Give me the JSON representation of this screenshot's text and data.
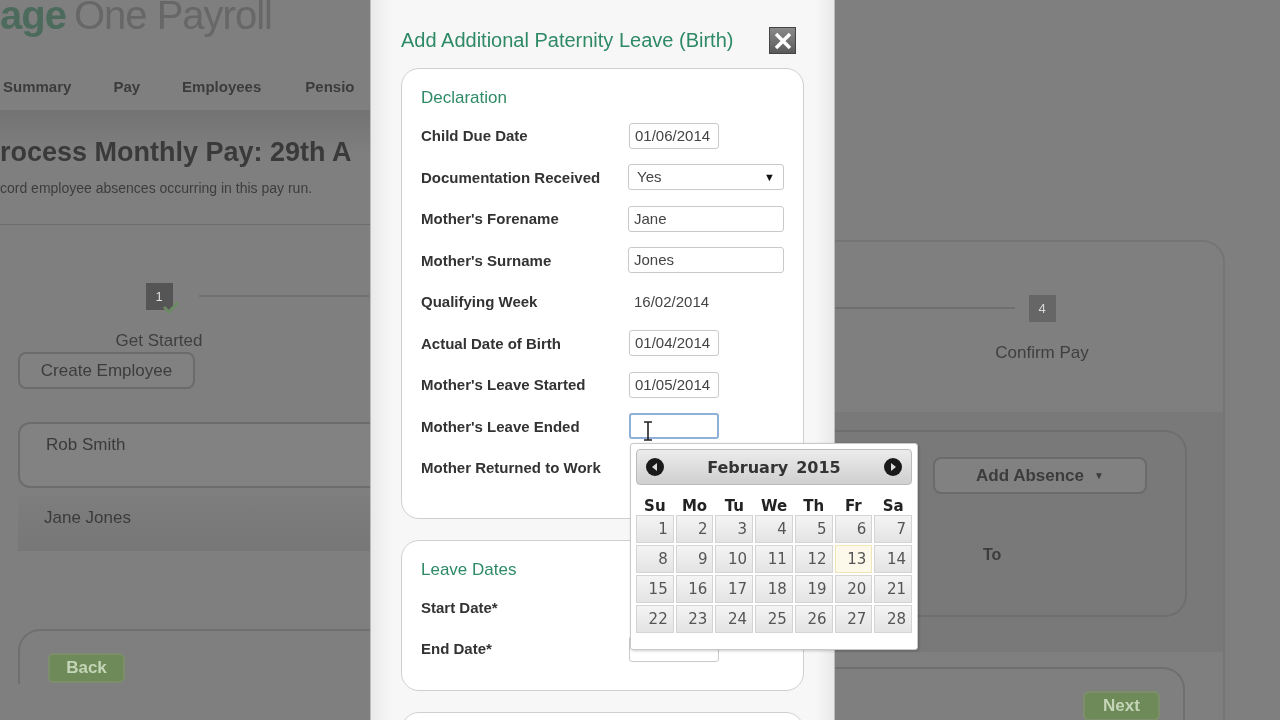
{
  "background": {
    "logo": {
      "brand": "age",
      "product": "One Payroll"
    },
    "nav": [
      {
        "label": "Summary"
      },
      {
        "label": "Pay"
      },
      {
        "label": "Employees"
      },
      {
        "label": "Pensio"
      }
    ],
    "heading": "rocess Monthly Pay: 29th A",
    "subheading": "cord employee absences occurring in this pay run.",
    "steps": [
      {
        "number": "1",
        "label": "Get Started",
        "completed": true
      },
      {
        "number": "4",
        "label": "Confirm Pay",
        "completed": false
      }
    ],
    "create_button": "Create Employee",
    "employees": [
      {
        "name": "Rob Smith",
        "selected": true
      },
      {
        "name": "Jane Jones",
        "selected": false
      }
    ],
    "absence": {
      "button": "Add Absence",
      "caret": "▼",
      "to_label": "To"
    },
    "back_button": "Back",
    "next_button": "Next"
  },
  "dialog": {
    "title": "Add Additional Paternity Leave (Birth)",
    "sections": [
      {
        "title": "Declaration",
        "fields": [
          {
            "label": "Child Due Date",
            "kind": "date",
            "value": "01/06/2014",
            "focused": false
          },
          {
            "label": "Documentation Received",
            "kind": "select",
            "value": "Yes",
            "caret": "▼",
            "focused": false
          },
          {
            "label": "Mother's Forename",
            "kind": "text",
            "value": "Jane",
            "focused": false
          },
          {
            "label": "Mother's Surname",
            "kind": "text",
            "value": "Jones",
            "focused": false
          },
          {
            "label": "Qualifying Week",
            "kind": "static",
            "value": "16/02/2014"
          },
          {
            "label": "Actual Date of Birth",
            "kind": "date",
            "value": "01/04/2014",
            "focused": false
          },
          {
            "label": "Mother's Leave Started",
            "kind": "date",
            "value": "01/05/2014",
            "focused": false
          },
          {
            "label": "Mother's Leave Ended",
            "kind": "date",
            "focused": true
          },
          {
            "label": "Mother Returned to Work",
            "kind": "covered"
          }
        ]
      },
      {
        "title": "Leave Dates",
        "fields": [
          {
            "label": "Start Date*",
            "kind": "covered"
          },
          {
            "label": "End Date*",
            "kind": "date",
            "focused": false
          }
        ]
      },
      {
        "kind": "blank"
      }
    ],
    "datepicker": {
      "month": "February",
      "year": "2015",
      "weekdays": [
        "Su",
        "Mo",
        "Tu",
        "We",
        "Th",
        "Fr",
        "Sa"
      ],
      "weeks": [
        [
          {
            "day": "1",
            "today": false
          },
          {
            "day": "2",
            "today": false
          },
          {
            "day": "3",
            "today": false
          },
          {
            "day": "4",
            "today": false
          },
          {
            "day": "5",
            "today": false
          },
          {
            "day": "6",
            "today": false
          },
          {
            "day": "7",
            "today": false
          }
        ],
        [
          {
            "day": "8",
            "today": false
          },
          {
            "day": "9",
            "today": false
          },
          {
            "day": "10",
            "today": false
          },
          {
            "day": "11",
            "today": false
          },
          {
            "day": "12",
            "today": false
          },
          {
            "day": "13",
            "today": true
          },
          {
            "day": "14",
            "today": false
          }
        ],
        [
          {
            "day": "15",
            "today": false
          },
          {
            "day": "16",
            "today": false
          },
          {
            "day": "17",
            "today": false
          },
          {
            "day": "18",
            "today": false
          },
          {
            "day": "19",
            "today": false
          },
          {
            "day": "20",
            "today": false
          },
          {
            "day": "21",
            "today": false
          }
        ],
        [
          {
            "day": "22",
            "today": false
          },
          {
            "day": "23",
            "today": false
          },
          {
            "day": "24",
            "today": false
          },
          {
            "day": "25",
            "today": false
          },
          {
            "day": "26",
            "today": false
          },
          {
            "day": "27",
            "today": false
          },
          {
            "day": "28",
            "today": false
          }
        ]
      ]
    }
  }
}
